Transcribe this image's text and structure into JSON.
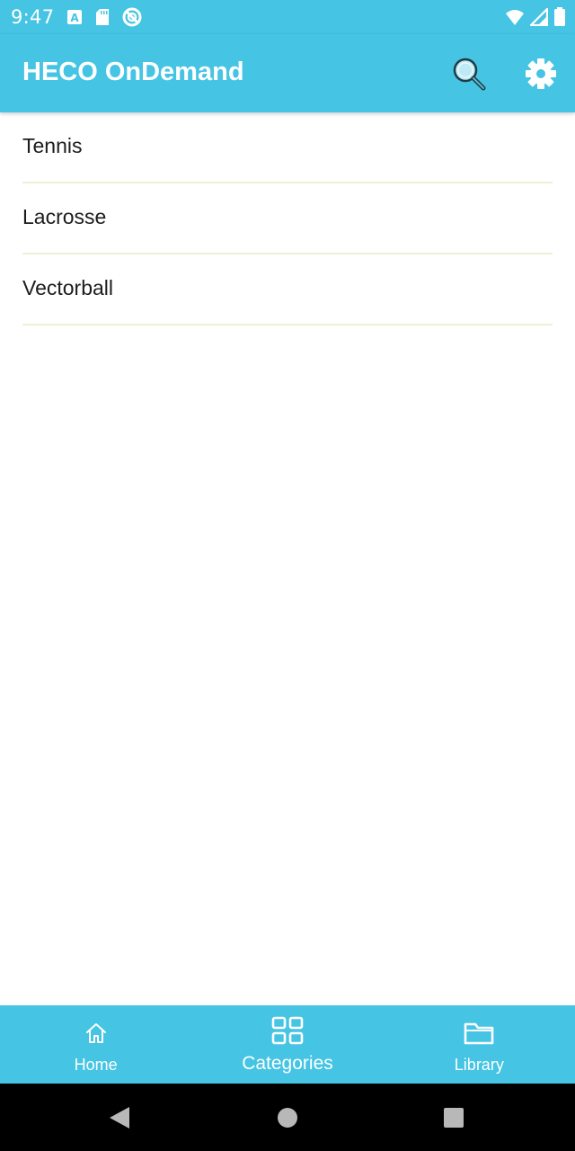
{
  "status_bar": {
    "time": "9:47",
    "left_icons": [
      "font-a-icon",
      "sd-card-icon",
      "no-disturb-icon"
    ],
    "right_icons": [
      "wifi-icon",
      "cell-signal-icon",
      "battery-icon"
    ]
  },
  "app_bar": {
    "title": "HECO OnDemand",
    "actions": [
      "search-icon",
      "gear-icon"
    ]
  },
  "categories": [
    {
      "label": "Tennis"
    },
    {
      "label": "Lacrosse"
    },
    {
      "label": "Vectorball"
    }
  ],
  "bottom_nav": {
    "items": [
      {
        "label": "Home",
        "icon": "home-icon"
      },
      {
        "label": "Categories",
        "icon": "grid-icon",
        "active": true
      },
      {
        "label": "Library",
        "icon": "folder-icon"
      }
    ]
  },
  "system_nav": {
    "buttons": [
      "back-icon",
      "home-circle-icon",
      "recents-square-icon"
    ]
  },
  "colors": {
    "primary": "#45c4e3",
    "on_primary": "#ffffff",
    "divider": "#eef0d5",
    "text": "#1c1c1c"
  }
}
